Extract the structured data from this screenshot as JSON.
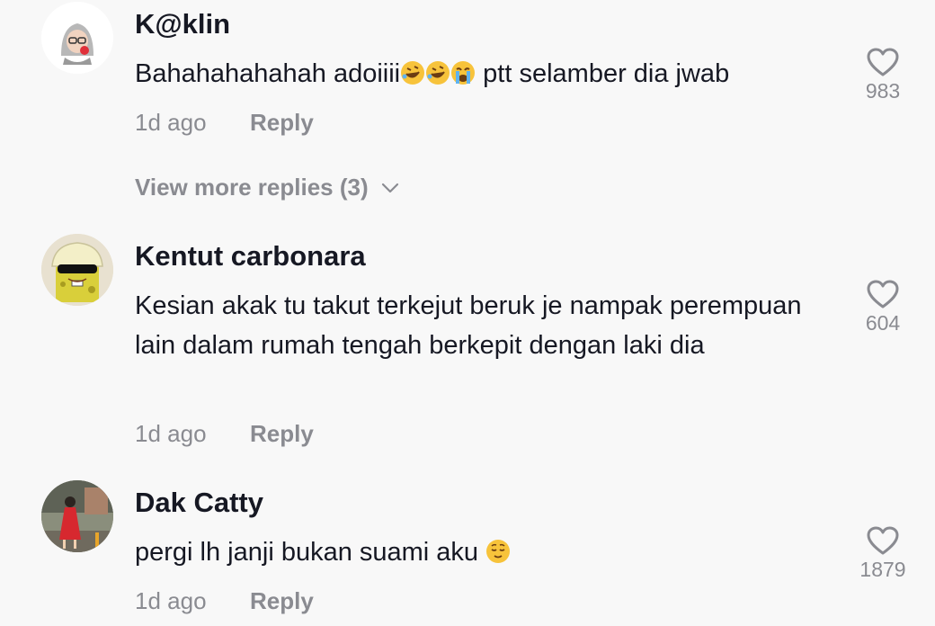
{
  "comments": [
    {
      "username": "K@klin",
      "text_prefix": "Bahahahahahah adoiiii",
      "emojis": [
        "rofl-emoji",
        "rofl-emoji",
        "loudly-crying-emoji"
      ],
      "text_suffix": " ptt selamber dia jwab",
      "time": "1d ago",
      "reply_label": "Reply",
      "likes": "983",
      "avatar": "avatar-hijab-sticker"
    },
    {
      "username": "Kentut carbonara",
      "text": "Kesian akak tu takut terkejut beruk je nampak perempuan lain dalam rumah tengah berkepit dengan laki dia",
      "time": "1d ago",
      "reply_label": "Reply",
      "likes": "604",
      "avatar": "avatar-spongebob-sunglasses"
    },
    {
      "username": "Dak Catty",
      "text_prefix": "pergi lh janji bukan suami aku ",
      "emojis": [
        "relieved-face-emoji"
      ],
      "time": "1d ago",
      "reply_label": "Reply",
      "likes": "1879",
      "avatar": "avatar-photo-woman-red-dress"
    }
  ],
  "view_more_replies": "View more replies (3)",
  "icons": {
    "like": "heart-outline-icon",
    "expand": "chevron-down-icon"
  },
  "colors": {
    "background": "#f8f8f8",
    "text": "#161823",
    "muted": "#8a8b91"
  }
}
